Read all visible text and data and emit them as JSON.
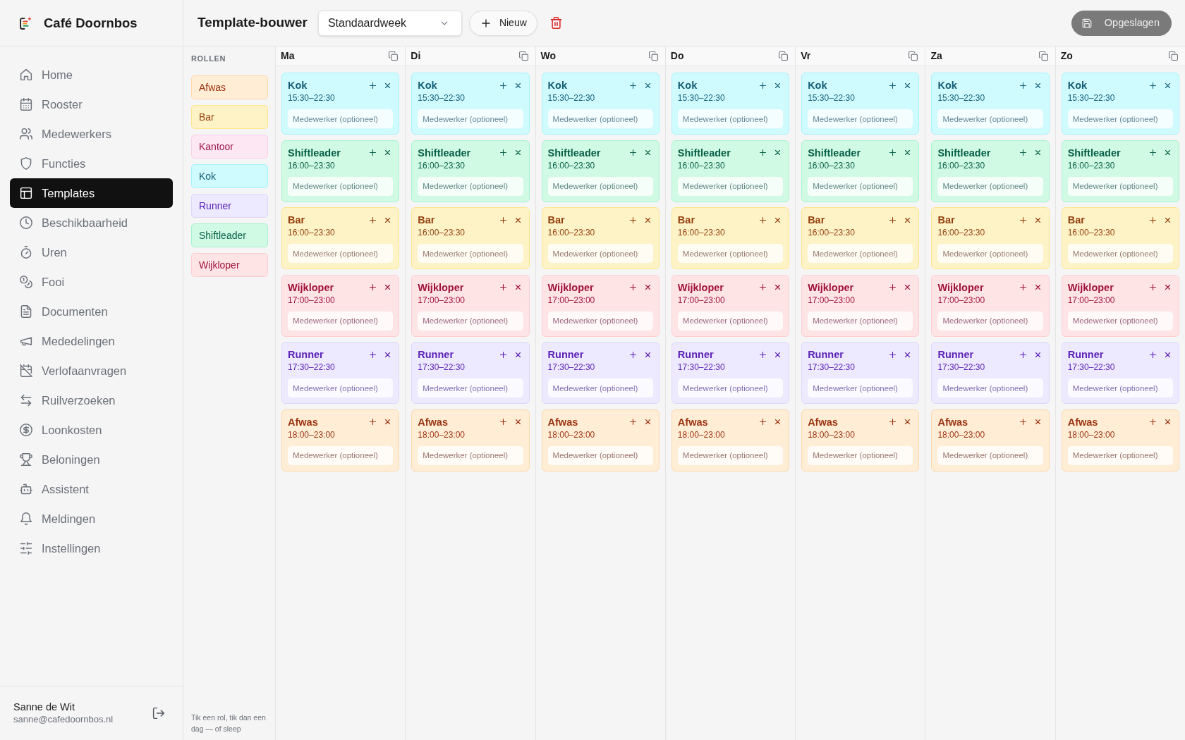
{
  "sidebar": {
    "brand": "Café Doornbos",
    "items": [
      {
        "label": "Home",
        "selected": false
      },
      {
        "label": "Rooster",
        "selected": false
      },
      {
        "label": "Medewerkers",
        "selected": false
      },
      {
        "label": "Functies",
        "selected": false
      },
      {
        "label": "Templates",
        "selected": true
      },
      {
        "label": "Beschikbaarheid",
        "selected": false
      },
      {
        "label": "Uren",
        "selected": false
      },
      {
        "label": "Fooi",
        "selected": false
      },
      {
        "label": "Documenten",
        "selected": false
      },
      {
        "label": "Mededelingen",
        "selected": false
      },
      {
        "label": "Verlofaanvragen",
        "selected": false
      },
      {
        "label": "Ruilverzoeken",
        "selected": false
      },
      {
        "label": "Loonkosten",
        "selected": false
      },
      {
        "label": "Beloningen",
        "selected": false
      },
      {
        "label": "Assistent",
        "selected": false
      },
      {
        "label": "Meldingen",
        "selected": false
      },
      {
        "label": "Instellingen",
        "selected": false
      }
    ],
    "user": {
      "name": "Sanne de Wit",
      "email": "sanne@cafedoornbos.nl"
    }
  },
  "header": {
    "title": "Template-bouwer",
    "template_select": {
      "value": "Standaardweek"
    },
    "new_button": "Nieuw",
    "save_button": {
      "label": "Opgeslagen",
      "disabled": true
    }
  },
  "roles": {
    "heading": "ROLLEN",
    "items": [
      {
        "name": "Afwas",
        "color": "#ffedd5"
      },
      {
        "name": "Bar",
        "color": "#fef3c7"
      },
      {
        "name": "Kantoor",
        "color": "#fce7f3"
      },
      {
        "name": "Kok",
        "color": "#cffafe"
      },
      {
        "name": "Runner",
        "color": "#ede9fe"
      },
      {
        "name": "Shiftleader",
        "color": "#d1fae5"
      },
      {
        "name": "Wijkloper",
        "color": "#ffe4e6"
      }
    ],
    "hint": "Tik een rol, tik dan een dag — of sleep"
  },
  "days": [
    {
      "label": "Ma",
      "shifts": [
        {
          "role": "Kok",
          "time": "15:30–22:30",
          "color": "#cffafe",
          "placeholder": "Medewerker (optioneel)"
        },
        {
          "role": "Shiftleader",
          "time": "16:00–23:30",
          "color": "#d1fae5",
          "placeholder": "Medewerker (optioneel)"
        },
        {
          "role": "Bar",
          "time": "16:00–23:30",
          "color": "#fef3c7",
          "placeholder": "Medewerker (optioneel)"
        },
        {
          "role": "Wijkloper",
          "time": "17:00–23:00",
          "color": "#ffe4e6",
          "placeholder": "Medewerker (optioneel)"
        },
        {
          "role": "Runner",
          "time": "17:30–22:30",
          "color": "#ede9fe",
          "placeholder": "Medewerker (optioneel)"
        },
        {
          "role": "Afwas",
          "time": "18:00–23:00",
          "color": "#ffedd5",
          "placeholder": "Medewerker (optioneel)"
        }
      ]
    },
    {
      "label": "Di",
      "shifts": [
        {
          "role": "Kok",
          "time": "15:30–22:30",
          "color": "#cffafe",
          "placeholder": "Medewerker (optioneel)"
        },
        {
          "role": "Shiftleader",
          "time": "16:00–23:30",
          "color": "#d1fae5",
          "placeholder": "Medewerker (optioneel)"
        },
        {
          "role": "Bar",
          "time": "16:00–23:30",
          "color": "#fef3c7",
          "placeholder": "Medewerker (optioneel)"
        },
        {
          "role": "Wijkloper",
          "time": "17:00–23:00",
          "color": "#ffe4e6",
          "placeholder": "Medewerker (optioneel)"
        },
        {
          "role": "Runner",
          "time": "17:30–22:30",
          "color": "#ede9fe",
          "placeholder": "Medewerker (optioneel)"
        },
        {
          "role": "Afwas",
          "time": "18:00–23:00",
          "color": "#ffedd5",
          "placeholder": "Medewerker (optioneel)"
        }
      ]
    },
    {
      "label": "Wo",
      "shifts": [
        {
          "role": "Kok",
          "time": "15:30–22:30",
          "color": "#cffafe",
          "placeholder": "Medewerker (optioneel)"
        },
        {
          "role": "Shiftleader",
          "time": "16:00–23:30",
          "color": "#d1fae5",
          "placeholder": "Medewerker (optioneel)"
        },
        {
          "role": "Bar",
          "time": "16:00–23:30",
          "color": "#fef3c7",
          "placeholder": "Medewerker (optioneel)"
        },
        {
          "role": "Wijkloper",
          "time": "17:00–23:00",
          "color": "#ffe4e6",
          "placeholder": "Medewerker (optioneel)"
        },
        {
          "role": "Runner",
          "time": "17:30–22:30",
          "color": "#ede9fe",
          "placeholder": "Medewerker (optioneel)"
        },
        {
          "role": "Afwas",
          "time": "18:00–23:00",
          "color": "#ffedd5",
          "placeholder": "Medewerker (optioneel)"
        }
      ]
    },
    {
      "label": "Do",
      "shifts": [
        {
          "role": "Kok",
          "time": "15:30–22:30",
          "color": "#cffafe",
          "placeholder": "Medewerker (optioneel)"
        },
        {
          "role": "Shiftleader",
          "time": "16:00–23:30",
          "color": "#d1fae5",
          "placeholder": "Medewerker (optioneel)"
        },
        {
          "role": "Bar",
          "time": "16:00–23:30",
          "color": "#fef3c7",
          "placeholder": "Medewerker (optioneel)"
        },
        {
          "role": "Wijkloper",
          "time": "17:00–23:00",
          "color": "#ffe4e6",
          "placeholder": "Medewerker (optioneel)"
        },
        {
          "role": "Runner",
          "time": "17:30–22:30",
          "color": "#ede9fe",
          "placeholder": "Medewerker (optioneel)"
        },
        {
          "role": "Afwas",
          "time": "18:00–23:00",
          "color": "#ffedd5",
          "placeholder": "Medewerker (optioneel)"
        }
      ]
    },
    {
      "label": "Vr",
      "shifts": [
        {
          "role": "Kok",
          "time": "15:30–22:30",
          "color": "#cffafe",
          "placeholder": "Medewerker (optioneel)"
        },
        {
          "role": "Shiftleader",
          "time": "16:00–23:30",
          "color": "#d1fae5",
          "placeholder": "Medewerker (optioneel)"
        },
        {
          "role": "Bar",
          "time": "16:00–23:30",
          "color": "#fef3c7",
          "placeholder": "Medewerker (optioneel)"
        },
        {
          "role": "Wijkloper",
          "time": "17:00–23:00",
          "color": "#ffe4e6",
          "placeholder": "Medewerker (optioneel)"
        },
        {
          "role": "Runner",
          "time": "17:30–22:30",
          "color": "#ede9fe",
          "placeholder": "Medewerker (optioneel)"
        },
        {
          "role": "Afwas",
          "time": "18:00–23:00",
          "color": "#ffedd5",
          "placeholder": "Medewerker (optioneel)"
        }
      ]
    },
    {
      "label": "Za",
      "shifts": [
        {
          "role": "Kok",
          "time": "15:30–22:30",
          "color": "#cffafe",
          "placeholder": "Medewerker (optioneel)"
        },
        {
          "role": "Shiftleader",
          "time": "16:00–23:30",
          "color": "#d1fae5",
          "placeholder": "Medewerker (optioneel)"
        },
        {
          "role": "Bar",
          "time": "16:00–23:30",
          "color": "#fef3c7",
          "placeholder": "Medewerker (optioneel)"
        },
        {
          "role": "Wijkloper",
          "time": "17:00–23:00",
          "color": "#ffe4e6",
          "placeholder": "Medewerker (optioneel)"
        },
        {
          "role": "Runner",
          "time": "17:30–22:30",
          "color": "#ede9fe",
          "placeholder": "Medewerker (optioneel)"
        },
        {
          "role": "Afwas",
          "time": "18:00–23:00",
          "color": "#ffedd5",
          "placeholder": "Medewerker (optioneel)"
        }
      ]
    },
    {
      "label": "Zo",
      "shifts": [
        {
          "role": "Kok",
          "time": "15:30–22:30",
          "color": "#cffafe",
          "placeholder": "Medewerker (optioneel)"
        },
        {
          "role": "Shiftleader",
          "time": "16:00–23:30",
          "color": "#d1fae5",
          "placeholder": "Medewerker (optioneel)"
        },
        {
          "role": "Bar",
          "time": "16:00–23:30",
          "color": "#fef3c7",
          "placeholder": "Medewerker (optioneel)"
        },
        {
          "role": "Wijkloper",
          "time": "17:00–23:00",
          "color": "#ffe4e6",
          "placeholder": "Medewerker (optioneel)"
        },
        {
          "role": "Runner",
          "time": "17:30–22:30",
          "color": "#ede9fe",
          "placeholder": "Medewerker (optioneel)"
        },
        {
          "role": "Afwas",
          "time": "18:00–23:00",
          "color": "#ffedd5",
          "placeholder": "Medewerker (optioneel)"
        }
      ]
    }
  ]
}
